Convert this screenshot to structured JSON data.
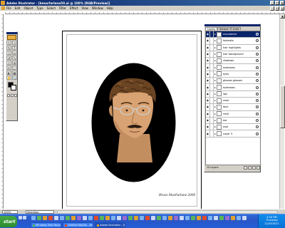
{
  "window": {
    "title": "Adobe Illustrator - [bmacfarlane50.ai @ 100% (RGB/Preview)]",
    "minimize": "_",
    "maximize": "□",
    "close": "x"
  },
  "menubar": {
    "items": [
      "File",
      "Edit",
      "Object",
      "Type",
      "Select",
      "Filter",
      "Effect",
      "View",
      "Window",
      "Help"
    ]
  },
  "toolbox": {
    "tools": [
      "↖",
      "↗",
      "✎",
      "T",
      "\\",
      "▭",
      "↺",
      "⤡",
      "⌇",
      "⊞",
      "✂",
      "⬚",
      "◐",
      "▦",
      "✋",
      "🔍"
    ]
  },
  "canvas": {
    "signature": "Bruce MacFarlane  2000",
    "colors": {
      "background_oval": "#000000",
      "skin": "#d8a272",
      "hair": "#6b4423",
      "moustache": "#2a1a10"
    }
  },
  "layers_panel": {
    "tabs": [
      "Layers",
      "Actions",
      "Links"
    ],
    "active_tab": "Layers",
    "layers": [
      {
        "name": "moustache",
        "selected": true
      },
      {
        "name": "footnote",
        "selected": false
      },
      {
        "name": "hair highlights",
        "selected": false
      },
      {
        "name": "hair background",
        "selected": false
      },
      {
        "name": "shadows",
        "selected": false
      },
      {
        "name": "eyebrows",
        "selected": false
      },
      {
        "name": "eyes",
        "selected": false
      },
      {
        "name": "glasses glasses",
        "selected": false
      },
      {
        "name": "eyebrows",
        "selected": false
      },
      {
        "name": "lips",
        "selected": false
      },
      {
        "name": "nose",
        "selected": false
      },
      {
        "name": "face",
        "selected": false
      },
      {
        "name": "neck",
        "selected": false
      },
      {
        "name": "ear",
        "selected": false
      },
      {
        "name": "oval",
        "selected": false
      },
      {
        "name": "Layer 3",
        "selected": false
      }
    ],
    "count_label": "13 Layers"
  },
  "statusbar": {
    "zoom": "100%",
    "status": "Selection"
  },
  "taskbar": {
    "start_label": "start",
    "tasks": [
      {
        "label": "Windows Task Manager",
        "active": false,
        "icon_color": "#5ab55a"
      },
      {
        "label": "Untitled Mozilla - Mozi...",
        "active": false,
        "icon_color": "#e04a2a"
      },
      {
        "label": "Adobe Illustrator - [bm...",
        "active": true,
        "icon_color": "#e0a030"
      }
    ],
    "clock": "5:24 PM",
    "day": "Thursday",
    "date": "12/29/2011"
  }
}
